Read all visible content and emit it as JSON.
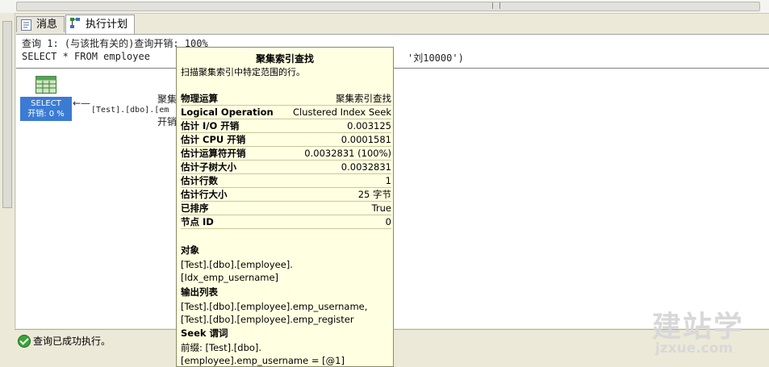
{
  "tabs": [
    {
      "label": "消息",
      "icon": "message-icon"
    },
    {
      "label": "执行计划",
      "icon": "execution-plan-icon"
    }
  ],
  "query": {
    "line1": "查询 1: (与该批有关的)查询开销: 100%",
    "line2": "SELECT * FROM employee",
    "line2_tail": "'刘10000')"
  },
  "plan": {
    "select_label": "SELECT",
    "select_cost": "开销: 0 %",
    "node_object": "[Test].[dbo].[em",
    "node_label1": "聚集",
    "node_label2": "开销"
  },
  "tooltip": {
    "title": "聚集索引查找",
    "description": "扫描聚集索引中特定范围的行。",
    "rows": [
      {
        "k": "物理运算",
        "v": "聚集索引查找"
      },
      {
        "k": "Logical Operation",
        "v": "Clustered Index Seek"
      },
      {
        "k": "估计 I/O 开销",
        "v": "0.003125"
      },
      {
        "k": "估计 CPU 开销",
        "v": "0.0001581"
      },
      {
        "k": "估计运算符开销",
        "v": "0.0032831 (100%)"
      },
      {
        "k": "估计子树大小",
        "v": "0.0032831"
      },
      {
        "k": "估计行数",
        "v": "1"
      },
      {
        "k": "估计行大小",
        "v": "25 字节"
      },
      {
        "k": "已排序",
        "v": "True"
      },
      {
        "k": "节点 ID",
        "v": "0"
      }
    ],
    "object_header": "对象",
    "object_lines": [
      "[Test].[dbo].[employee].",
      "[Idx_emp_username]"
    ],
    "output_header": "输出列表",
    "output_lines": [
      "[Test].[dbo].[employee].emp_username,",
      "[Test].[dbo].[employee].emp_register"
    ],
    "seek_header": "Seek 谓词",
    "seek_lines": [
      "前缀: [Test].[dbo].",
      "[employee].emp_username = [@1]"
    ]
  },
  "status": {
    "text": "查询已成功执行。"
  },
  "watermark": {
    "big": "建站学",
    "small": "jzxue.com"
  }
}
